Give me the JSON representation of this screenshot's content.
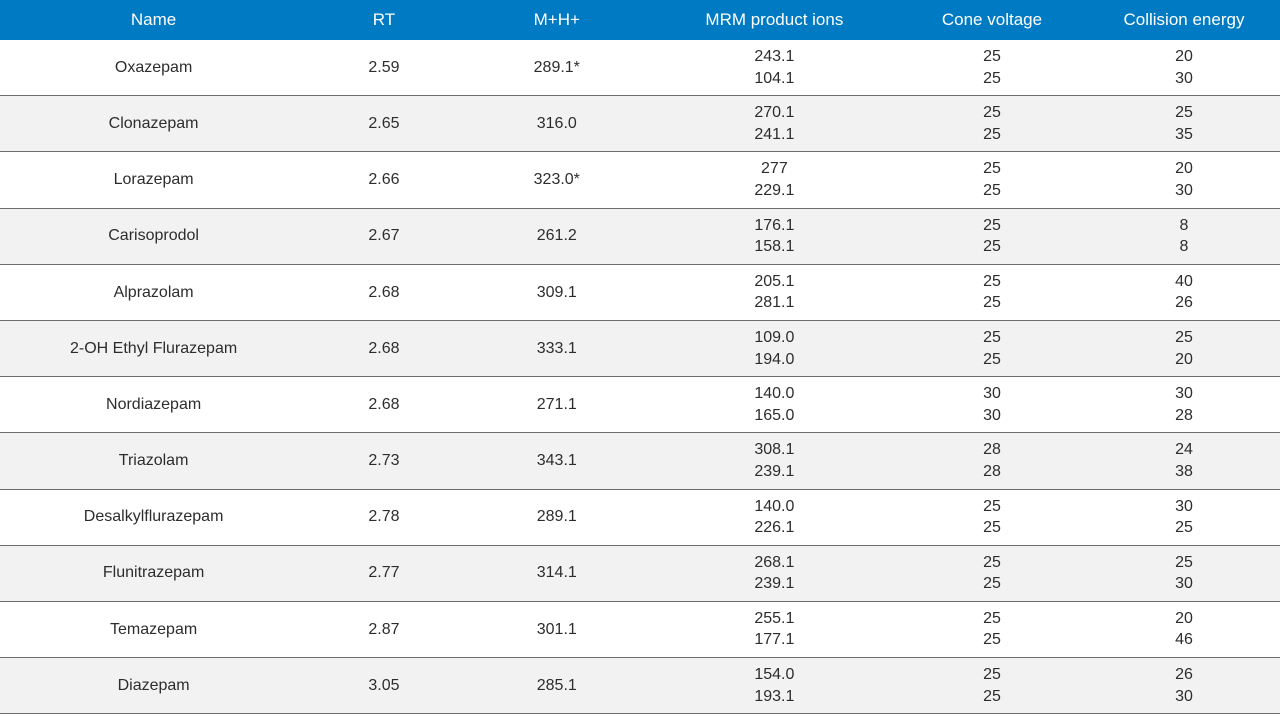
{
  "headers": {
    "name": "Name",
    "rt": "RT",
    "mh": "M+H+",
    "mrm": "MRM product ions",
    "cone": "Cone voltage",
    "ce": "Collision energy"
  },
  "rows": [
    {
      "name": "Oxazepam",
      "rt": "2.59",
      "mh": "289.1*",
      "mrm": [
        "243.1",
        "104.1"
      ],
      "cone": [
        "25",
        "25"
      ],
      "ce": [
        "20",
        "30"
      ]
    },
    {
      "name": "Clonazepam",
      "rt": "2.65",
      "mh": "316.0",
      "mrm": [
        "270.1",
        "241.1"
      ],
      "cone": [
        "25",
        "25"
      ],
      "ce": [
        "25",
        "35"
      ]
    },
    {
      "name": "Lorazepam",
      "rt": "2.66",
      "mh": "323.0*",
      "mrm": [
        "277",
        "229.1"
      ],
      "cone": [
        "25",
        "25"
      ],
      "ce": [
        "20",
        "30"
      ]
    },
    {
      "name": "Carisoprodol",
      "rt": "2.67",
      "mh": "261.2",
      "mrm": [
        "176.1",
        "158.1"
      ],
      "cone": [
        "25",
        "25"
      ],
      "ce": [
        "8",
        "8"
      ]
    },
    {
      "name": "Alprazolam",
      "rt": "2.68",
      "mh": "309.1",
      "mrm": [
        "205.1",
        "281.1"
      ],
      "cone": [
        "25",
        "25"
      ],
      "ce": [
        "40",
        "26"
      ]
    },
    {
      "name": "2-OH Ethyl Flurazepam",
      "rt": "2.68",
      "mh": "333.1",
      "mrm": [
        "109.0",
        "194.0"
      ],
      "cone": [
        "25",
        "25"
      ],
      "ce": [
        "25",
        "20"
      ]
    },
    {
      "name": "Nordiazepam",
      "rt": "2.68",
      "mh": "271.1",
      "mrm": [
        "140.0",
        "165.0"
      ],
      "cone": [
        "30",
        "30"
      ],
      "ce": [
        "30",
        "28"
      ]
    },
    {
      "name": "Triazolam",
      "rt": "2.73",
      "mh": "343.1",
      "mrm": [
        "308.1",
        "239.1"
      ],
      "cone": [
        "28",
        "28"
      ],
      "ce": [
        "24",
        "38"
      ]
    },
    {
      "name": "Desalkylflurazepam",
      "rt": "2.78",
      "mh": "289.1",
      "mrm": [
        "140.0",
        "226.1"
      ],
      "cone": [
        "25",
        "25"
      ],
      "ce": [
        "30",
        "25"
      ]
    },
    {
      "name": "Flunitrazepam",
      "rt": "2.77",
      "mh": "314.1",
      "mrm": [
        "268.1",
        "239.1"
      ],
      "cone": [
        "25",
        "25"
      ],
      "ce": [
        "25",
        "30"
      ]
    },
    {
      "name": "Temazepam",
      "rt": "2.87",
      "mh": "301.1",
      "mrm": [
        "255.1",
        "177.1"
      ],
      "cone": [
        "25",
        "25"
      ],
      "ce": [
        "20",
        "46"
      ]
    },
    {
      "name": "Diazepam",
      "rt": "3.05",
      "mh": "285.1",
      "mrm": [
        "154.0",
        "193.1"
      ],
      "cone": [
        "25",
        "25"
      ],
      "ce": [
        "26",
        "30"
      ]
    }
  ]
}
